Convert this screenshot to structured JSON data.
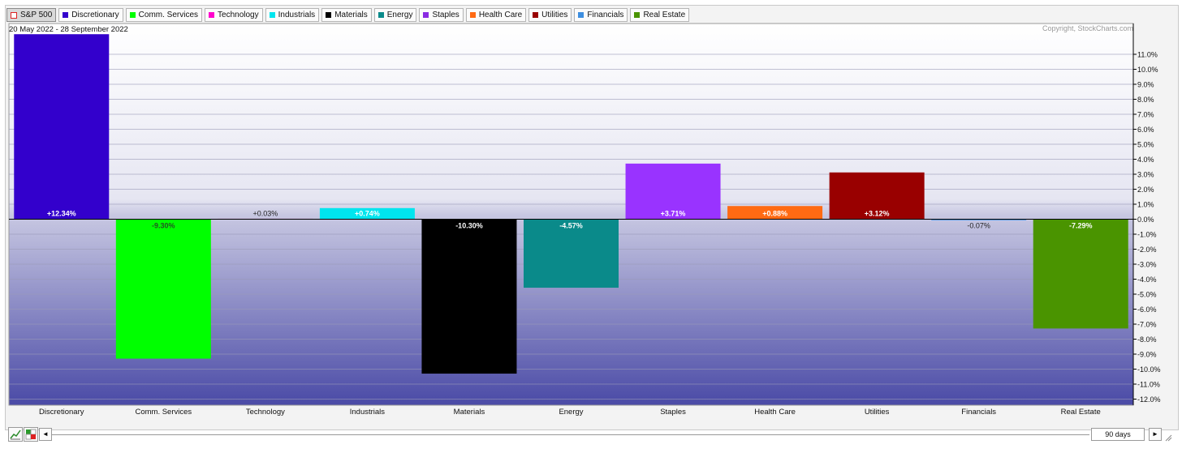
{
  "legend": [
    {
      "label": "S&P 500",
      "color": "#ffffff",
      "hollow": true,
      "selected": true
    },
    {
      "label": "Discretionary",
      "color": "#3300cc"
    },
    {
      "label": "Comm. Services",
      "color": "#00ff00"
    },
    {
      "label": "Technology",
      "color": "#ff00cc"
    },
    {
      "label": "Industrials",
      "color": "#00e5ee"
    },
    {
      "label": "Materials",
      "color": "#000000"
    },
    {
      "label": "Energy",
      "color": "#0a8a8a"
    },
    {
      "label": "Staples",
      "color": "#8a2be2"
    },
    {
      "label": "Health Care",
      "color": "#ff6a13"
    },
    {
      "label": "Utilities",
      "color": "#990000"
    },
    {
      "label": "Financials",
      "color": "#3d8ee0"
    },
    {
      "label": "Real Estate",
      "color": "#4a9400"
    }
  ],
  "date_range": "20 May 2022 - 28 September 2022",
  "copyright": "Copyright, StockCharts.com",
  "period_label": "90 days",
  "icons": {
    "chart_type": "line-chart-icon",
    "sector_toggle": "sector-grid-icon",
    "prev": "◄",
    "next": "►"
  },
  "chart_data": {
    "type": "bar",
    "categories": [
      "Discretionary",
      "Comm. Services",
      "Technology",
      "Industrials",
      "Materials",
      "Energy",
      "Staples",
      "Health Care",
      "Utilities",
      "Financials",
      "Real Estate"
    ],
    "values": [
      12.34,
      -9.3,
      0.03,
      0.74,
      -10.3,
      -4.57,
      3.71,
      0.88,
      3.12,
      -0.07,
      -7.29
    ],
    "value_labels": [
      "+12.34%",
      "-9.30%",
      "+0.03%",
      "+0.74%",
      "-10.30%",
      "-4.57%",
      "+3.71%",
      "+0.88%",
      "+3.12%",
      "-0.07%",
      "-7.29%"
    ],
    "colors": [
      "#3300cc",
      "#00ff00",
      "#cc0099",
      "#00e5ee",
      "#000000",
      "#0a8a8a",
      "#9933ff",
      "#ff6a13",
      "#990000",
      "#3d8ee0",
      "#4a9400"
    ],
    "ylim": [
      -12.5,
      12.5
    ],
    "y_ticks": [
      11,
      10,
      9,
      8,
      7,
      6,
      5,
      4,
      3,
      2,
      1,
      0,
      -1,
      -2,
      -3,
      -4,
      -5,
      -6,
      -7,
      -8,
      -9,
      -10,
      -11,
      -12
    ],
    "y_tick_labels": [
      "11.0%",
      "10.0%",
      "9.0%",
      "8.0%",
      "7.0%",
      "6.0%",
      "5.0%",
      "4.0%",
      "3.0%",
      "2.0%",
      "1.0%",
      "0.0%",
      "-1.0%",
      "-2.0%",
      "-3.0%",
      "-4.0%",
      "-5.0%",
      "-6.0%",
      "-7.0%",
      "-8.0%",
      "-9.0%",
      "-10.0%",
      "-11.0%",
      "-12.0%"
    ],
    "grid": true,
    "title": "",
    "xlabel": "",
    "ylabel": ""
  }
}
